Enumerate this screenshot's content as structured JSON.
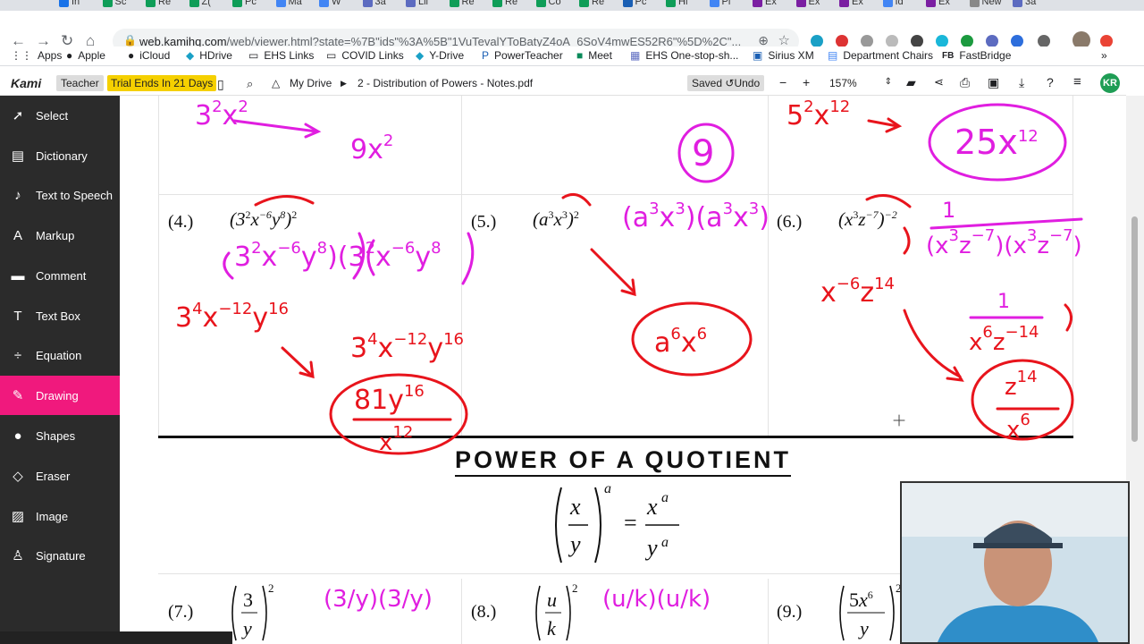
{
  "tabs": [
    "In",
    "Sc",
    "Re",
    "Z(",
    "Pc",
    "Ma",
    "W",
    "3á",
    "Lil",
    "Re",
    "Re",
    "Co",
    "Re",
    "Pc",
    "Hi",
    "Pl",
    "Ex",
    "Ex",
    "Ex",
    "Id",
    "Ex",
    "New",
    "3á"
  ],
  "address": {
    "url_host": "web.kamihq.com",
    "url_path": "/web/viewer.html?state=%7B\"ids\"%3A%5B\"1VuTevalYToBatyZ4oA_6SoV4mwES52R6\"%5D%2C\"..."
  },
  "bookmarks": [
    {
      "icon": "apps-icon",
      "label": "Apps"
    },
    {
      "icon": "apple-icon",
      "label": "Apple"
    },
    {
      "icon": "apple-icon",
      "label": "iCloud"
    },
    {
      "icon": "drive-icon",
      "label": "HDrive"
    },
    {
      "icon": "folder-icon",
      "label": "EHS Links"
    },
    {
      "icon": "folder-icon",
      "label": "COVID Links"
    },
    {
      "icon": "drive-icon",
      "label": "Y-Drive"
    },
    {
      "icon": "powerteacher-icon",
      "label": "PowerTeacher"
    },
    {
      "icon": "meet-icon",
      "label": "Meet"
    },
    {
      "icon": "grid-icon",
      "label": "EHS One-stop-sh..."
    },
    {
      "icon": "sirius-icon",
      "label": "Sirius XM"
    },
    {
      "icon": "doc-icon",
      "label": "Department Chairs"
    },
    {
      "icon": "fb-icon",
      "label": "FastBridge"
    }
  ],
  "kami": {
    "logo": "Kami",
    "teacher": "Teacher",
    "trial": "Trial Ends In 21 Days",
    "drive": "My Drive",
    "doc_title": "2 - Distribution of Powers - Notes.pdf",
    "saved": "Saved",
    "undo": "Undo",
    "zoom": "157%",
    "avatar": "KR"
  },
  "tools": [
    {
      "icon": "cursor-icon",
      "label": "Select"
    },
    {
      "icon": "book-icon",
      "label": "Dictionary"
    },
    {
      "icon": "speaker-icon",
      "label": "Text to Speech"
    },
    {
      "icon": "marker-icon",
      "label": "Markup"
    },
    {
      "icon": "comment-icon",
      "label": "Comment"
    },
    {
      "icon": "textbox-icon",
      "label": "Text Box"
    },
    {
      "icon": "equation-icon",
      "label": "Equation"
    },
    {
      "icon": "brush-icon",
      "label": "Drawing"
    },
    {
      "icon": "shapes-icon",
      "label": "Shapes"
    },
    {
      "icon": "eraser-icon",
      "label": "Eraser"
    },
    {
      "icon": "image-icon",
      "label": "Image"
    },
    {
      "icon": "signature-icon",
      "label": "Signature"
    }
  ],
  "drawing": {
    "size": "2",
    "colors": [
      "#f71c1c",
      "#00e000",
      "#ee00ee"
    ]
  },
  "doc": {
    "problems": [
      {
        "number": "(4.)"
      },
      {
        "number": "(5.)"
      },
      {
        "number": "(6.)"
      },
      {
        "number": "(7.)"
      },
      {
        "number": "(8.)"
      },
      {
        "number": "(9.)"
      }
    ],
    "section_title": "POWER OF A QUOTIENT"
  }
}
